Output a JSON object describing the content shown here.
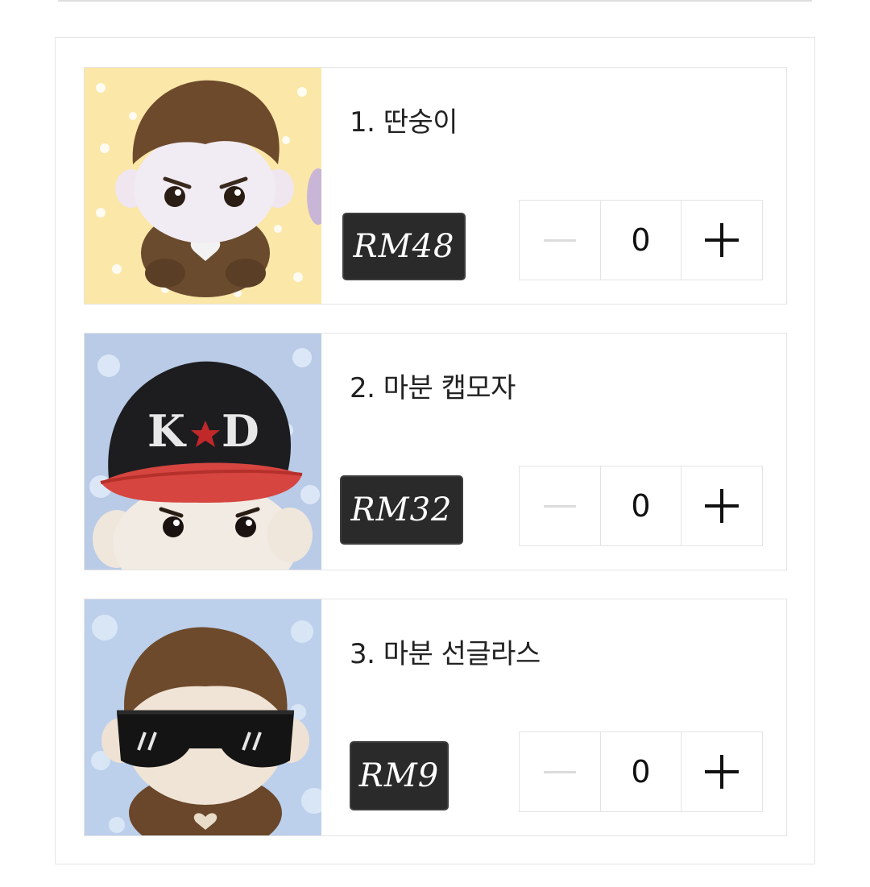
{
  "products": [
    {
      "name": "1. 딴숭이",
      "price": "RM48",
      "quantity": "0"
    },
    {
      "name": "2. 마분 캡모자",
      "price": "RM32",
      "quantity": "0"
    },
    {
      "name": "3. 마분 선글라스",
      "price": "RM9",
      "quantity": "0"
    }
  ],
  "colors": {
    "price_badge": "#2a2a2a",
    "border": "#e4e4e4",
    "thumb_bg_1": "#fbe7a8",
    "thumb_bg_2": "#b9cbe6",
    "thumb_bg_3": "#bcd0ec"
  },
  "icons": {
    "decrease": "minus-icon",
    "increase": "plus-icon"
  }
}
